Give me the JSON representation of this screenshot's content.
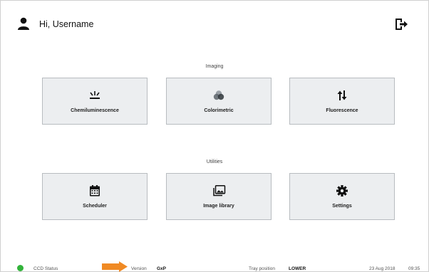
{
  "header": {
    "greeting": "Hi, Username"
  },
  "imaging": {
    "title": "Imaging",
    "tiles": [
      {
        "label": "Chemiluminescence",
        "icon": "chemiluminescence-icon"
      },
      {
        "label": "Colorimetric",
        "icon": "colorimetric-icon"
      },
      {
        "label": "Fluorescence",
        "icon": "fluorescence-icon"
      }
    ]
  },
  "utilities": {
    "title": "Utilities",
    "tiles": [
      {
        "label": "Scheduler",
        "icon": "calendar-icon"
      },
      {
        "label": "Image library",
        "icon": "image-library-icon"
      },
      {
        "label": "Settings",
        "icon": "gear-icon"
      }
    ]
  },
  "footer": {
    "ccd_status_label": "CCD Status",
    "ccd_status_color": "#32b33a",
    "version_label": "Version",
    "version_value": "GxP",
    "tray_label": "Tray position",
    "tray_value": "LOWER",
    "date": "23 Aug 2018",
    "time": "09:35"
  },
  "colors": {
    "tile_bg": "#eceef0",
    "arrow": "#f08a24"
  }
}
